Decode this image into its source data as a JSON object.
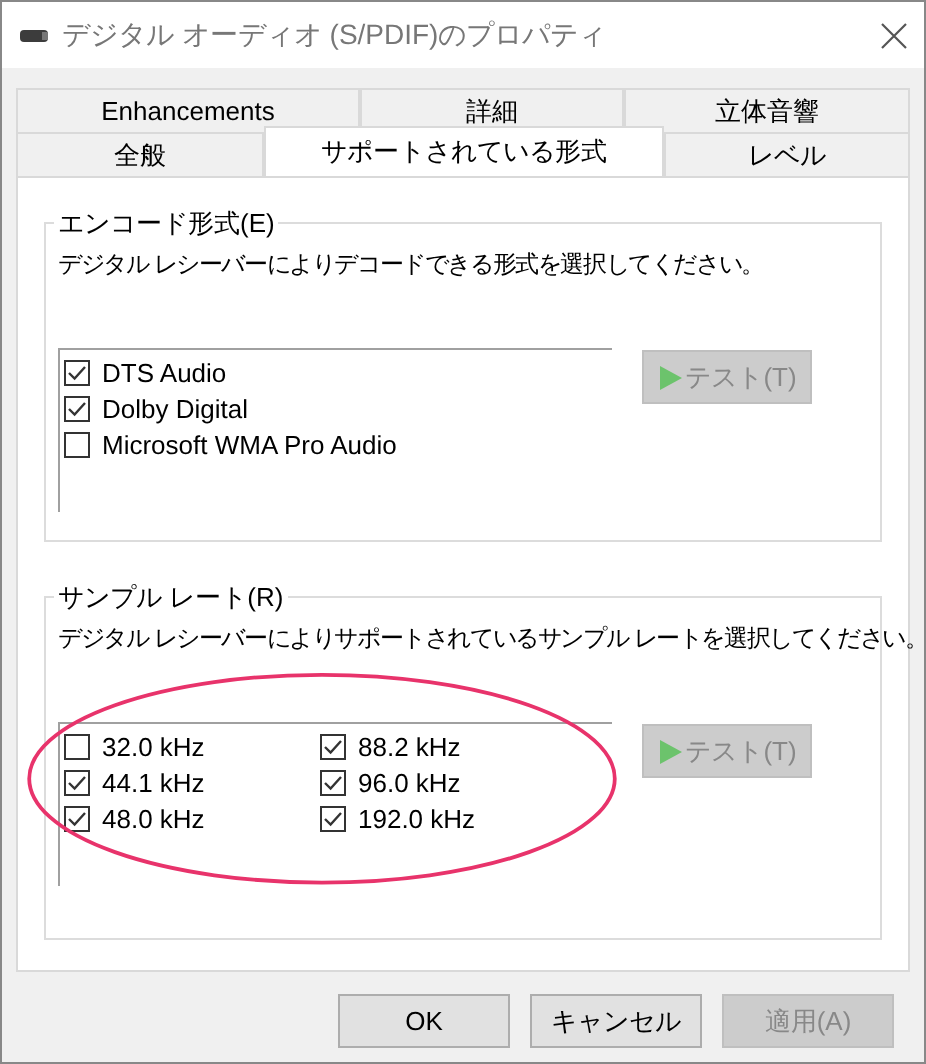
{
  "window": {
    "title": "デジタル オーディオ (S/PDIF)のプロパティ"
  },
  "tab_rows": [
    [
      {
        "label": "Enhancements",
        "selected": false
      },
      {
        "label": "詳細",
        "selected": false
      },
      {
        "label": "立体音響",
        "selected": false
      }
    ],
    [
      {
        "label": "全般",
        "selected": false
      },
      {
        "label": "サポートされている形式",
        "selected": true
      },
      {
        "label": "レベル",
        "selected": false
      }
    ]
  ],
  "groups": [
    {
      "title": "エンコード形式(E)",
      "description": "デジタル レシーバーによりデコードできる形式を選択してください。",
      "items": [
        {
          "label": "DTS Audio",
          "checked": true
        },
        {
          "label": "Dolby Digital",
          "checked": true
        },
        {
          "label": "Microsoft WMA Pro Audio",
          "checked": false
        }
      ],
      "test_button": {
        "label": "テスト(T)",
        "disabled": true
      }
    },
    {
      "title": "サンプル レート(R)",
      "description": "デジタル レシーバーによりサポートされているサンプル レートを選択してください。",
      "items": [
        {
          "label": "32.0 kHz",
          "checked": false
        },
        {
          "label": "44.1 kHz",
          "checked": true
        },
        {
          "label": "48.0 kHz",
          "checked": true
        },
        {
          "label": "88.2 kHz",
          "checked": true
        },
        {
          "label": "96.0 kHz",
          "checked": true
        },
        {
          "label": "192.0 kHz",
          "checked": true
        }
      ],
      "test_button": {
        "label": "テスト(T)",
        "disabled": true
      }
    }
  ],
  "buttons": [
    {
      "label": "OK",
      "disabled": false
    },
    {
      "label": "キャンセル",
      "disabled": false
    },
    {
      "label": "適用(A)",
      "disabled": true
    }
  ]
}
